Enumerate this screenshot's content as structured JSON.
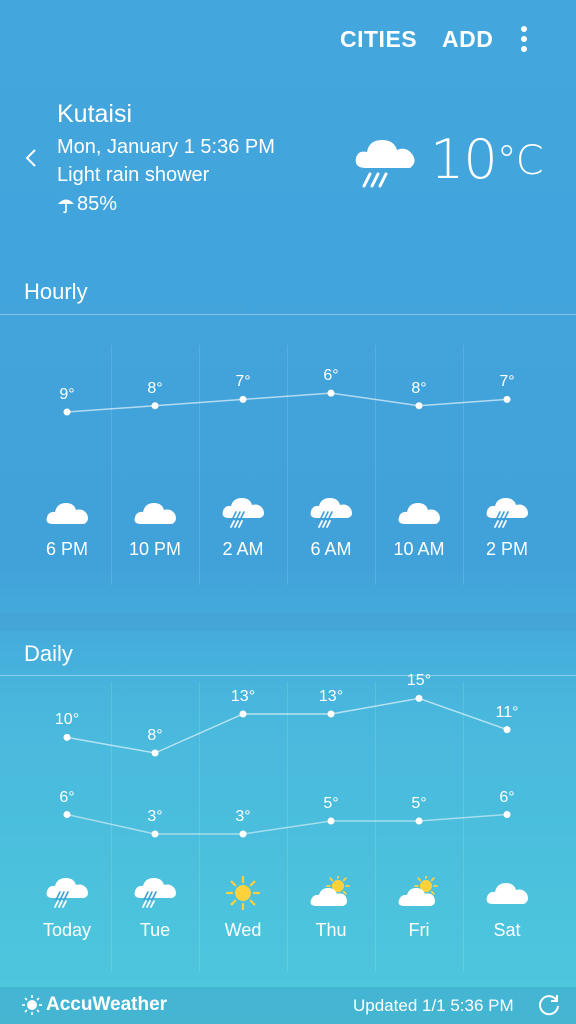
{
  "toolbar": {
    "cities_label": "CITIES",
    "add_label": "ADD",
    "menu_icon": "more-vert-icon"
  },
  "current": {
    "city": "Kutaisi",
    "datetime": "Mon, January 1 5:36 PM",
    "condition": "Light rain shower",
    "precip": "85%",
    "temperature": "10",
    "unit": "°C",
    "icon": "rain-cloud-icon"
  },
  "hourly": {
    "title": "Hourly",
    "items": [
      {
        "time": "6 PM",
        "temp": "9°",
        "value": 9,
        "icon": "cloud"
      },
      {
        "time": "10 PM",
        "temp": "8°",
        "value": 8,
        "icon": "cloud"
      },
      {
        "time": "2 AM",
        "temp": "7°",
        "value": 7,
        "icon": "rain"
      },
      {
        "time": "6 AM",
        "temp": "6°",
        "value": 6,
        "icon": "rain"
      },
      {
        "time": "10 AM",
        "temp": "8°",
        "value": 8,
        "icon": "cloud"
      },
      {
        "time": "2 PM",
        "temp": "7°",
        "value": 7,
        "icon": "rain"
      }
    ]
  },
  "daily": {
    "title": "Daily",
    "items": [
      {
        "day": "Today",
        "high": "10°",
        "low": "6°",
        "high_value": 10,
        "low_value": 6,
        "icon": "rain"
      },
      {
        "day": "Tue",
        "high": "8°",
        "low": "3°",
        "high_value": 8,
        "low_value": 3,
        "icon": "rain"
      },
      {
        "day": "Wed",
        "high": "13°",
        "low": "3°",
        "high_value": 13,
        "low_value": 3,
        "icon": "sun"
      },
      {
        "day": "Thu",
        "high": "13°",
        "low": "5°",
        "high_value": 13,
        "low_value": 5,
        "icon": "sun-cloud"
      },
      {
        "day": "Fri",
        "high": "15°",
        "low": "5°",
        "high_value": 15,
        "low_value": 5,
        "icon": "sun-cloud"
      },
      {
        "day": "Sat",
        "high": "11°",
        "low": "6°",
        "high_value": 11,
        "low_value": 6,
        "icon": "cloud"
      }
    ]
  },
  "footer": {
    "brand": "AccuWeather",
    "updated": "Updated 1/1  5:36 PM"
  },
  "colors": {
    "background_top": "#43a6dd",
    "background_bottom": "#4ec9dd",
    "sun": "#ffd23c",
    "text": "#ffffff"
  }
}
